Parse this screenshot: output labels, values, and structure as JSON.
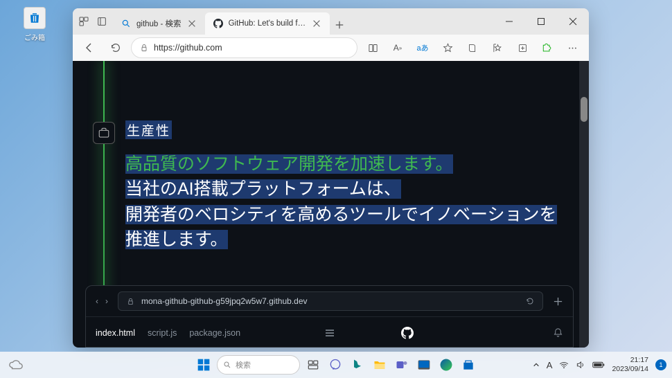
{
  "desktop": {
    "recycle_bin_label": "ごみ箱"
  },
  "browser": {
    "tabs": [
      {
        "title": "github - 検索"
      },
      {
        "title": "GitHub: Let's build from here · Gi..."
      }
    ],
    "url": "https://github.com"
  },
  "page": {
    "badge": "生産性",
    "headline_green": "高品質のソフトウェア開発を加速します。",
    "headline_white_l1": "当社のAI搭載プラットフォームは、",
    "headline_white_l2": "開発者のベロシティを高めるツールでイノベーションを推進します。",
    "codepanel": {
      "url": "mona-github-github-g59jpq2w5w7.github.dev",
      "tabs": [
        "index.html",
        "script.js",
        "package.json"
      ]
    }
  },
  "taskbar": {
    "search_placeholder": "検索",
    "ime_mode": "A",
    "time": "21:17",
    "date": "2023/09/14",
    "notif_count": "1"
  }
}
